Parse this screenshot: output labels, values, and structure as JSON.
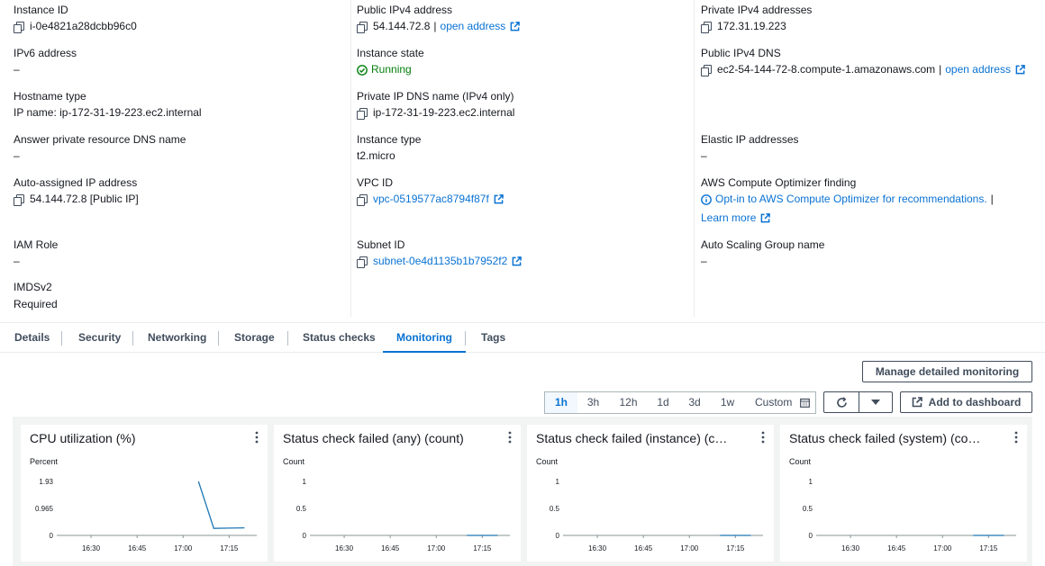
{
  "details": {
    "instance_id": {
      "label": "Instance ID",
      "value": "i-0e4821a28dcbb96c0"
    },
    "public_ipv4": {
      "label": "Public IPv4 address",
      "value": "54.144.72.8",
      "link": "open address"
    },
    "private_ipv4": {
      "label": "Private IPv4 addresses",
      "value": "172.31.19.223"
    },
    "ipv6": {
      "label": "IPv6 address",
      "value": "–"
    },
    "instance_state": {
      "label": "Instance state",
      "value": "Running"
    },
    "public_dns": {
      "label": "Public IPv4 DNS",
      "value": "ec2-54-144-72-8.compute-1.amazonaws.com",
      "link": "open address"
    },
    "hostname_type": {
      "label": "Hostname type",
      "value": "IP name: ip-172-31-19-223.ec2.internal"
    },
    "private_dns": {
      "label": "Private IP DNS name (IPv4 only)",
      "value": "ip-172-31-19-223.ec2.internal"
    },
    "answer_dns": {
      "label": "Answer private resource DNS name",
      "value": "–"
    },
    "instance_type": {
      "label": "Instance type",
      "value": "t2.micro"
    },
    "elastic_ip": {
      "label": "Elastic IP addresses",
      "value": "–"
    },
    "auto_ip": {
      "label": "Auto-assigned IP address",
      "value": "54.144.72.8 [Public IP]"
    },
    "vpc_id": {
      "label": "VPC ID",
      "value": "vpc-0519577ac8794f87f"
    },
    "optimizer": {
      "label": "AWS Compute Optimizer finding",
      "value": "Opt-in to AWS Compute Optimizer for recommendations.",
      "sep": "|",
      "learn": "Learn more"
    },
    "iam_role": {
      "label": "IAM Role",
      "value": "–"
    },
    "subnet_id": {
      "label": "Subnet ID",
      "value": "subnet-0e4d1135b1b7952f2"
    },
    "asg_name": {
      "label": "Auto Scaling Group name",
      "value": "–"
    },
    "imdsv2": {
      "label": "IMDSv2",
      "value": "Required"
    }
  },
  "tabs": [
    "Details",
    "Security",
    "Networking",
    "Storage",
    "Status checks",
    "Monitoring",
    "Tags"
  ],
  "active_tab": "Monitoring",
  "monitoring": {
    "manage_button": "Manage detailed monitoring",
    "ranges": [
      "1h",
      "3h",
      "12h",
      "1d",
      "3d",
      "1w",
      "Custom"
    ],
    "active_range": "1h",
    "add_dashboard": "Add to dashboard"
  },
  "colors": {
    "link": "#0972d3",
    "success": "#037f0c",
    "series": "#1f77b4"
  },
  "chart_data": [
    {
      "type": "line",
      "title": "CPU utilization (%)",
      "ylabel": "Percent",
      "yticks": [
        "1.93",
        "0.965",
        "0"
      ],
      "ylim": [
        0,
        1.93
      ],
      "xticks": [
        "16:30",
        "16:45",
        "17:00",
        "17:15"
      ],
      "series": [
        {
          "x": [
            "17:05",
            "17:10",
            "17:15",
            "17:20"
          ],
          "values": [
            1.93,
            0.25,
            0.26,
            0.27
          ]
        }
      ]
    },
    {
      "type": "line",
      "title": "Status check failed (any) (count)",
      "ylabel": "Count",
      "yticks": [
        "1",
        "0.5",
        "0"
      ],
      "ylim": [
        0,
        1
      ],
      "xticks": [
        "16:30",
        "16:45",
        "17:00",
        "17:15"
      ],
      "series": [
        {
          "x": [
            "17:10",
            "17:15",
            "17:20"
          ],
          "values": [
            0,
            0,
            0
          ]
        }
      ]
    },
    {
      "type": "line",
      "title": "Status check failed (instance) (c…",
      "ylabel": "Count",
      "yticks": [
        "1",
        "0.5",
        "0"
      ],
      "ylim": [
        0,
        1
      ],
      "xticks": [
        "16:30",
        "16:45",
        "17:00",
        "17:15"
      ],
      "series": [
        {
          "x": [
            "17:10",
            "17:15",
            "17:20"
          ],
          "values": [
            0,
            0,
            0
          ]
        }
      ]
    },
    {
      "type": "line",
      "title": "Status check failed (system) (co…",
      "ylabel": "Count",
      "yticks": [
        "1",
        "0.5",
        "0"
      ],
      "ylim": [
        0,
        1
      ],
      "xticks": [
        "16:30",
        "16:45",
        "17:00",
        "17:15"
      ],
      "series": [
        {
          "x": [
            "17:10",
            "17:15",
            "17:20"
          ],
          "values": [
            0,
            0,
            0
          ]
        }
      ]
    }
  ]
}
